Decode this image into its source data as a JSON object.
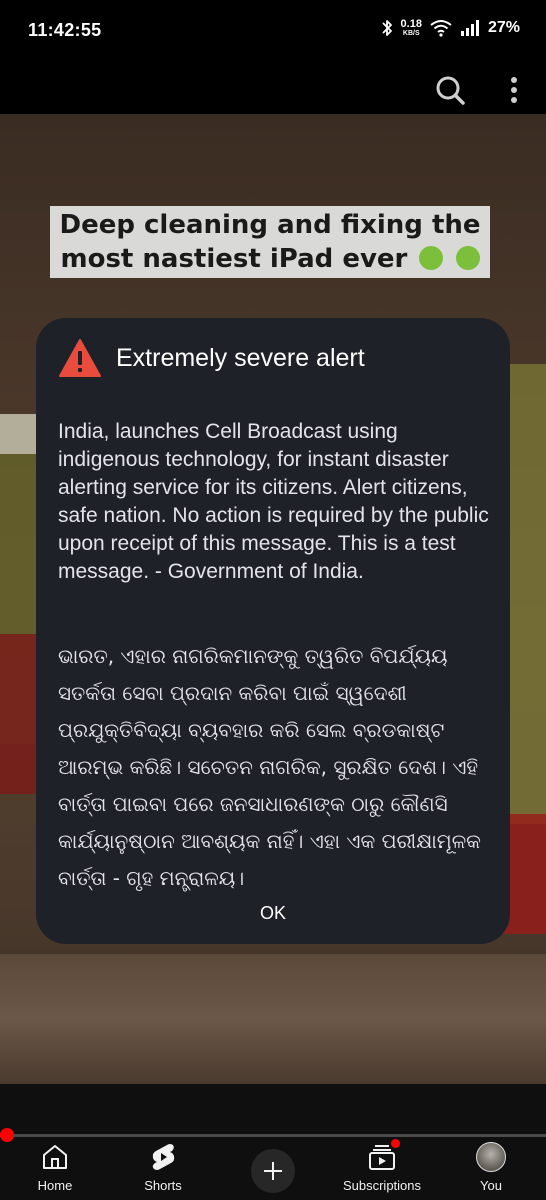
{
  "status_bar": {
    "time": "11:42:55",
    "net_speed_value": "0.18",
    "net_speed_unit": "KB/S",
    "battery": "27%"
  },
  "video": {
    "caption": "Deep cleaning and fixing the most nastiest iPad ever"
  },
  "alert": {
    "title": "Extremely severe alert",
    "body_en": "India, launches Cell Broadcast using indigenous technology, for instant disaster alerting service for its citizens. Alert citizens, safe nation. No action is required by the public upon receipt of this message. This is a test message. - Government of India.",
    "body_or": "ଭାରତ, ଏହାର ନାଗରିକମାନଙ୍କୁ ତ୍ୱରିତ ବିପର୍ଯ୍ୟୟ ସତର୍କତା ସେବା ପ୍ରଦାନ କରିବା ପାଇଁ ସ୍ୱଦେଶୀ ପ୍ରଯୁକ୍ତିବିଦ୍ୟା ବ୍ୟବହାର କରି ସେଲ ବ୍ରଡକାଷ୍ଟ ଆରମ୍ଭ କରିଛି। ସଚେତନ ନାଗରିକ, ସୁରକ୍ଷିତ ଦେଶ। ଏହି ବାର୍ତ୍ତା ପାଇବା ପରେ ଜନସାଧାରଣଙ୍କ ଠାରୁ କୌଣସି କାର୍ଯ୍ୟାନୁଷ୍ଠାନ ଆବଶ୍ୟକ ନାହିଁ। ଏହା ଏକ ପରୀକ୍ଷାମୂଳକ ବାର୍ତ୍ତା - ଗୃହ ମନ୍ତ୍ରାଳୟ।",
    "ok_label": "OK",
    "icon": "warning-icon",
    "icon_color": "#e94b3c"
  },
  "playback": {
    "progress": 0.01,
    "accent": "#ff0000"
  },
  "nav": {
    "home": "Home",
    "shorts": "Shorts",
    "subscriptions": "Subscriptions",
    "you": "You"
  }
}
